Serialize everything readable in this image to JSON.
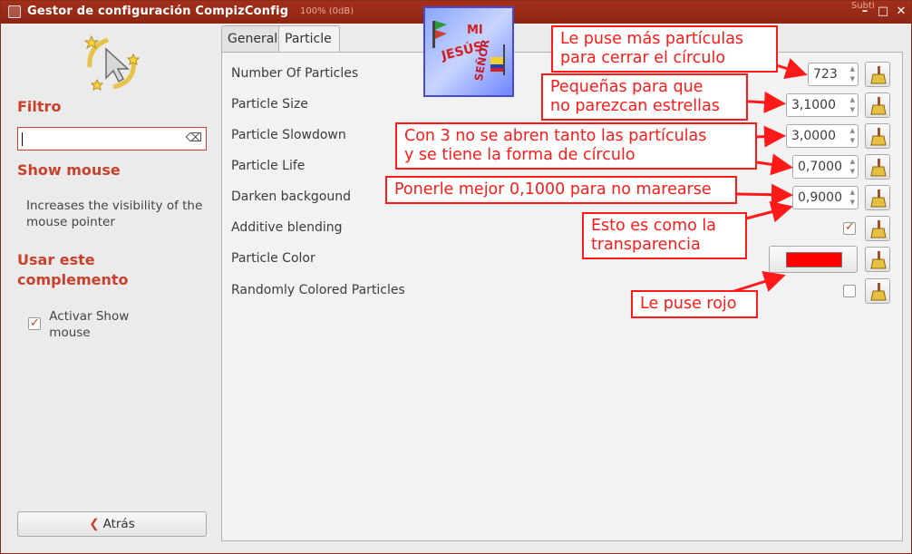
{
  "window": {
    "title": "Gestor de configuración CompizConfig",
    "ghost_text": "100% (0dB)",
    "ghost_text_right": "Subti"
  },
  "sidebar": {
    "filter_heading": "Filtro",
    "filter_value": "",
    "plugin_name": "Show mouse",
    "plugin_description": "Increases the visibility of the mouse pointer",
    "use_heading": "Usar este complemento",
    "enable_label": "Activar Show mouse",
    "enable_checked": true,
    "back_label": "Atrás"
  },
  "tabs": [
    {
      "label": "General",
      "active": false
    },
    {
      "label": "Particle Options",
      "active": true
    }
  ],
  "options": [
    {
      "label": "Number Of Particles",
      "value": "723"
    },
    {
      "label": "Particle Size",
      "value": "3,1000"
    },
    {
      "label": "Particle Slowdown",
      "value": "3,0000"
    },
    {
      "label": "Particle Life",
      "value": "0,7000"
    },
    {
      "label": "Darken backgound",
      "value": "0,9000"
    },
    {
      "label": "Additive blending",
      "checked": true
    },
    {
      "label": "Particle Color",
      "color": "#ff0000"
    },
    {
      "label": "Randomly Colored Particles",
      "checked": false
    }
  ],
  "logo": {
    "lines": [
      "MI",
      "JESÚS",
      "SEÑOR"
    ]
  },
  "annotations": [
    "Le puse más partículas\npara cerrar el círculo",
    "Pequeñas para que\nno parezcan estrellas",
    "Con 3 no se abren tanto las partículas\ny se tiene la forma de círculo",
    "Ponerle mejor 0,1000 para no marearse",
    "Esto es como la\ntransparencia",
    "Le puse rojo"
  ],
  "colors": {
    "accent": "#c8412c",
    "titlebar": "#9a2c17",
    "annotation": "#ff1a1a"
  }
}
